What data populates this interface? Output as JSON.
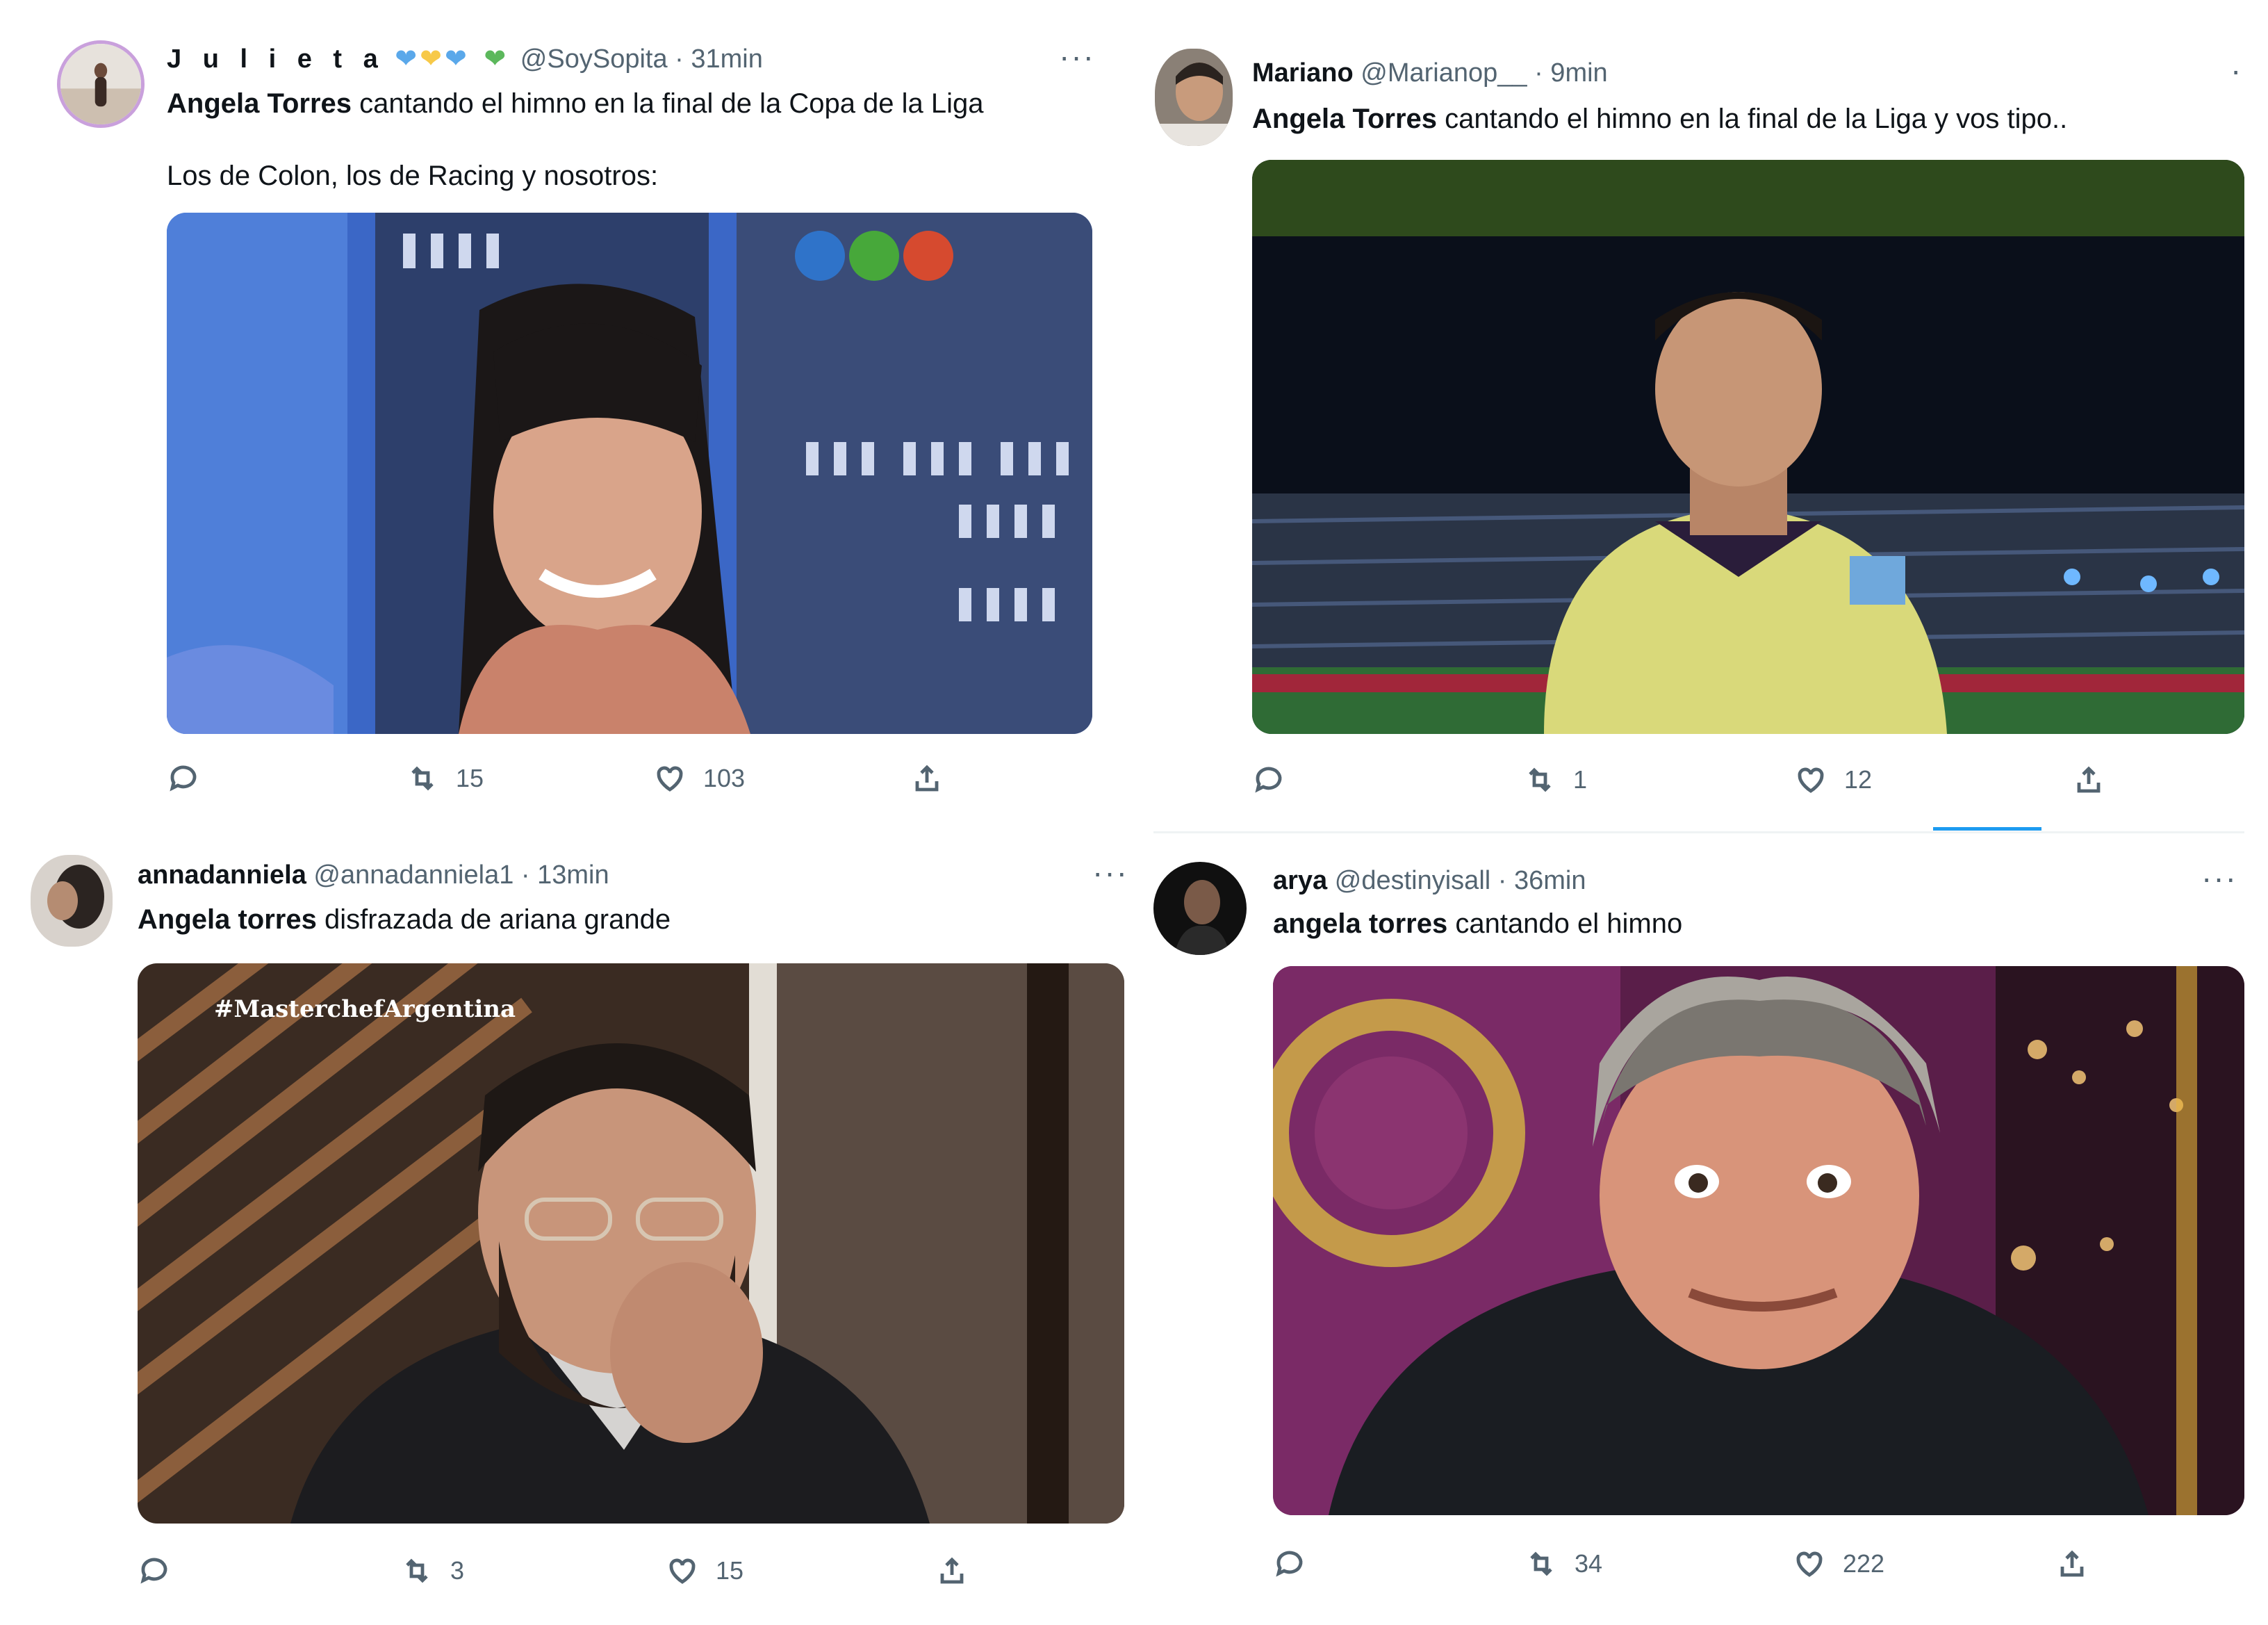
{
  "tweets": [
    {
      "name": "J u l i e t a",
      "hearts": [
        "#1d9bf0",
        "#f7c948",
        "#1d9bf0",
        "#4caf50"
      ],
      "handle": "@SoySopita",
      "time": "· 31min",
      "bold": "Angela Torres",
      "text": " cantando el himno en la final de la Copa de la Liga",
      "text2": "Los de Colon, los de Racing y nosotros:",
      "media_caption": "",
      "replies": "",
      "retweets": "15",
      "likes": "103"
    },
    {
      "name": "Mariano",
      "handle": "@Marianop__",
      "time": "· 9min",
      "bold": "Angela Torres",
      "text": " cantando el himno en la final de la Liga y vos tipo..",
      "media_caption": "",
      "replies": "",
      "retweets": "1",
      "likes": "12"
    },
    {
      "name": "annadanniela",
      "handle": "@annadanniela1",
      "time": "· 13min",
      "bold": "Angela torres",
      "text": " disfrazada de ariana grande",
      "media_caption": "#MasterchefArgentina",
      "replies": "",
      "retweets": "3",
      "likes": "15"
    },
    {
      "name": "arya",
      "handle": "@destinyisall",
      "time": "· 36min",
      "bold": "angela torres",
      "text": " cantando el himno",
      "media_caption": "",
      "replies": "",
      "retweets": "34",
      "likes": "222"
    }
  ],
  "more_label": "···",
  "icons": [
    "reply-icon",
    "retweet-icon",
    "like-icon",
    "share-icon"
  ]
}
